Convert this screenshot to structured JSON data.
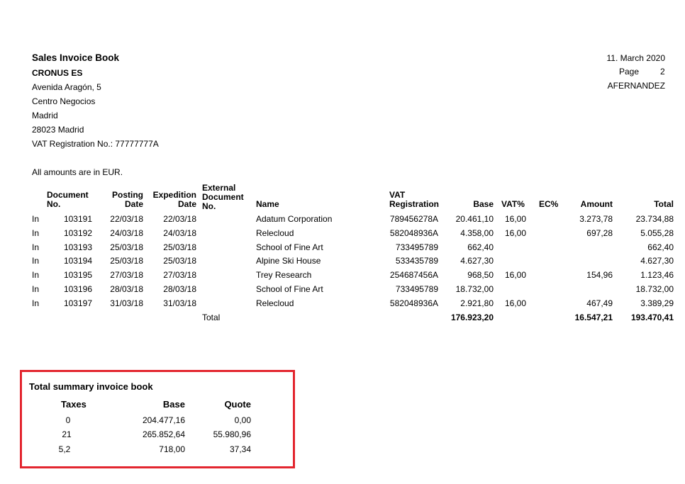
{
  "header": {
    "report_title": "Sales Invoice Book",
    "company_name": "CRONUS ES",
    "address": [
      "Avenida Aragón, 5",
      "Centro Negocios",
      "Madrid",
      "28023 Madrid"
    ],
    "vat_registration": "VAT Registration No.: 77777777A",
    "date": "11. March 2020",
    "page_label": "Page",
    "page_number": "2",
    "user": "AFERNANDEZ"
  },
  "amounts_note": "All amounts are in EUR.",
  "columns": {
    "document_no_1": "Document",
    "document_no_2": "No.",
    "posting_1": "Posting",
    "posting_2": "Date",
    "expedition_1": "Expedition",
    "expedition_2": "Date",
    "external_1": "External",
    "external_2": "Document",
    "external_3": "No.",
    "name": "Name",
    "vat_reg_1": "VAT",
    "vat_reg_2": "Registration",
    "base": "Base",
    "vat_pct": "VAT%",
    "ec_pct": "EC%",
    "amount": "Amount",
    "total": "Total"
  },
  "rows": [
    {
      "type": "In",
      "doc": "103191",
      "posting": "22/03/18",
      "expedition": "22/03/18",
      "external": "",
      "name": "Adatum Corporation",
      "vat_reg": "789456278A",
      "base": "20.461,10",
      "vat_pct": "16,00",
      "ec_pct": "",
      "amount": "3.273,78",
      "total": "23.734,88"
    },
    {
      "type": "In",
      "doc": "103192",
      "posting": "24/03/18",
      "expedition": "24/03/18",
      "external": "",
      "name": "Relecloud",
      "vat_reg": "582048936A",
      "base": "4.358,00",
      "vat_pct": "16,00",
      "ec_pct": "",
      "amount": "697,28",
      "total": "5.055,28"
    },
    {
      "type": "In",
      "doc": "103193",
      "posting": "25/03/18",
      "expedition": "25/03/18",
      "external": "",
      "name": "School of Fine Art",
      "vat_reg": "733495789",
      "base": "662,40",
      "vat_pct": "",
      "ec_pct": "",
      "amount": "",
      "total": "662,40"
    },
    {
      "type": "In",
      "doc": "103194",
      "posting": "25/03/18",
      "expedition": "25/03/18",
      "external": "",
      "name": "Alpine Ski House",
      "vat_reg": "533435789",
      "base": "4.627,30",
      "vat_pct": "",
      "ec_pct": "",
      "amount": "",
      "total": "4.627,30"
    },
    {
      "type": "In",
      "doc": "103195",
      "posting": "27/03/18",
      "expedition": "27/03/18",
      "external": "",
      "name": "Trey Research",
      "vat_reg": "254687456A",
      "base": "968,50",
      "vat_pct": "16,00",
      "ec_pct": "",
      "amount": "154,96",
      "total": "1.123,46"
    },
    {
      "type": "In",
      "doc": "103196",
      "posting": "28/03/18",
      "expedition": "28/03/18",
      "external": "",
      "name": "School of Fine Art",
      "vat_reg": "733495789",
      "base": "18.732,00",
      "vat_pct": "",
      "ec_pct": "",
      "amount": "",
      "total": "18.732,00"
    },
    {
      "type": "In",
      "doc": "103197",
      "posting": "31/03/18",
      "expedition": "31/03/18",
      "external": "",
      "name": "Relecloud",
      "vat_reg": "582048936A",
      "base": "2.921,80",
      "vat_pct": "16,00",
      "ec_pct": "",
      "amount": "467,49",
      "total": "3.389,29"
    }
  ],
  "totals": {
    "label": "Total",
    "base": "176.923,20",
    "amount": "16.547,21",
    "total": "193.470,41"
  },
  "summary": {
    "title": "Total summary invoice book",
    "col_taxes": "Taxes",
    "col_base": "Base",
    "col_quote": "Quote",
    "rows": [
      {
        "taxes": "0",
        "base": "204.477,16",
        "quote": "0,00"
      },
      {
        "taxes": "21",
        "base": "265.852,64",
        "quote": "55.980,96"
      },
      {
        "taxes": "5,2",
        "base": "718,00",
        "quote": "37,34"
      }
    ],
    "highlight_color": "#e3262f"
  }
}
